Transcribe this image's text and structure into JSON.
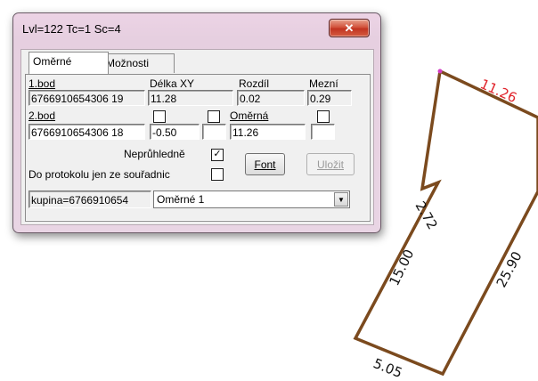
{
  "window": {
    "title": "Lvl=122 Tc=1 Sc=4",
    "close_symbol": "✕"
  },
  "tabs": [
    {
      "label": "Oměrné",
      "active": true
    },
    {
      "label": "Možnosti",
      "active": false
    }
  ],
  "form": {
    "bod1_label": "1.bod",
    "bod1_value": "6766910654306 19",
    "delka_label": "Délka XY",
    "delka_value": "11.28",
    "rozdil_label": "Rozdíl",
    "rozdil_value": "0.02",
    "mezni_label": "Mezní",
    "mezni_value": "0.29",
    "bod2_label": "2.bod",
    "bod2_value": "6766910654306 18",
    "offset_value": "-0.50",
    "omerna_label": "Oměrná",
    "omerna_value": "11.26",
    "opaque_label": "Neprůhledně",
    "opaque_checked": "✓",
    "protocol_label": "Do protokolu jen ze souřadnic",
    "font_button": "Font",
    "save_button": "Uložit",
    "group_field": "kupina=6766910654",
    "type_select": "Oměrné 1",
    "select_arrow": "▼"
  },
  "drawing": {
    "line_color": "#7b4a1e",
    "highlight_color": "#e0242c",
    "labels": {
      "top": "11.26",
      "right": "25.90",
      "notch": "2.72",
      "left": "15.00",
      "bottom": "5.05"
    }
  }
}
